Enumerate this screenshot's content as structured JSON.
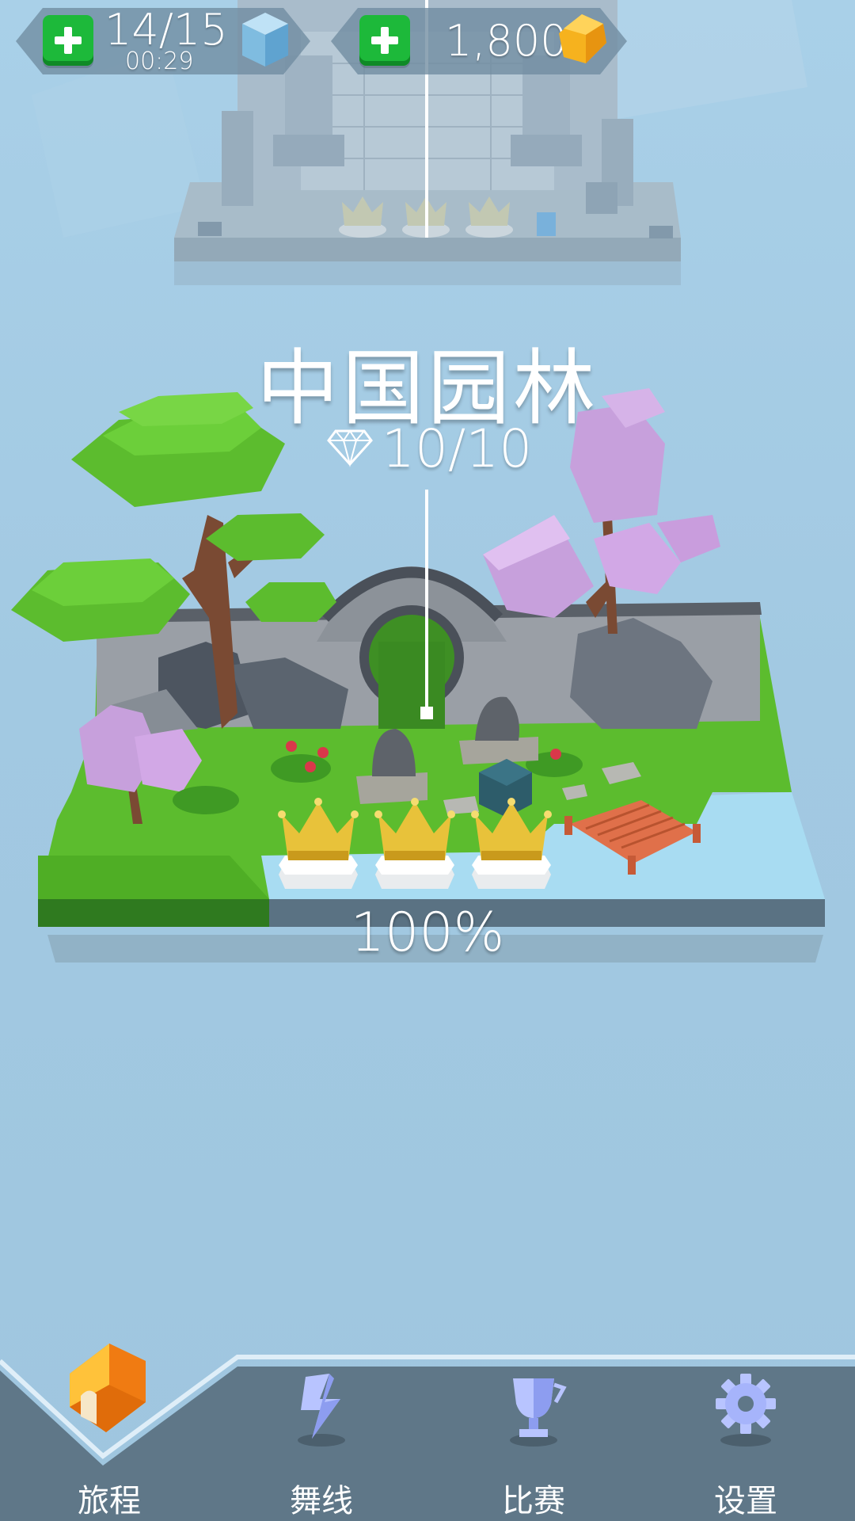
{
  "hud": {
    "lives": {
      "value": "14/15",
      "timer": "00:29",
      "plus_icon": "plus-icon",
      "icon": "blue-cube-icon"
    },
    "currency": {
      "value": "1,800",
      "plus_icon": "plus-icon",
      "icon": "gold-cube-icon"
    }
  },
  "level": {
    "title": "中国园林",
    "gems": "10/10",
    "gem_icon": "diamond-icon",
    "progress": "100%",
    "progress_value": 1.0,
    "crowns_earned": 3,
    "crowns_total": 3
  },
  "nav": {
    "items": [
      {
        "label": "旅程",
        "icon": "house-icon",
        "active": true
      },
      {
        "label": "舞线",
        "icon": "dance-line-icon",
        "active": false
      },
      {
        "label": "比赛",
        "icon": "trophy-icon",
        "active": false
      },
      {
        "label": "设置",
        "icon": "gear-icon",
        "active": false
      }
    ]
  },
  "colors": {
    "background": "#a4cbe4",
    "nav_bar": "#5f7788",
    "grass": "#5cbc2e",
    "blossom": "#d6a8e8",
    "crown": "#e8c23a",
    "plus_button": "#1db93a",
    "coin": "#f6b21e"
  }
}
